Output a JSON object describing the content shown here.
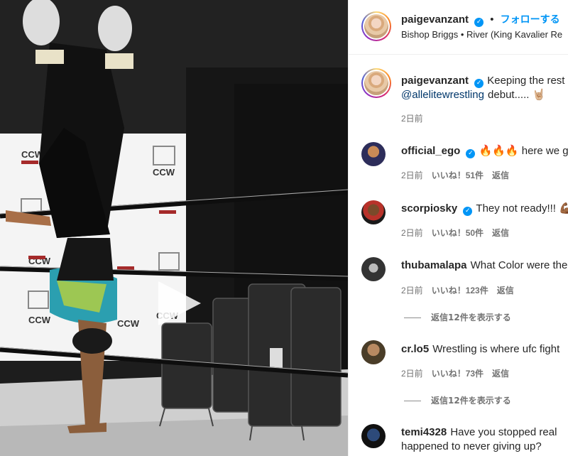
{
  "post": {
    "username": "paigevanzant",
    "follow_label": "フォローする",
    "separator": "•",
    "audio_artist": "Bishop Briggs",
    "audio_title": "River (King Kavalier Re",
    "video": {
      "banner_logo": "CCW",
      "play_icon": "play-icon"
    }
  },
  "caption": {
    "username": "paigevanzant",
    "text": "Keeping the rest",
    "mention": "@allelitewrestling",
    "text2": "debut..... 🤘🏼",
    "time": "2日前"
  },
  "comments": [
    {
      "username": "official_ego",
      "verified": true,
      "text": "🔥🔥🔥 here we go",
      "time": "2日前",
      "likes": "いいね！51件",
      "reply": "返信"
    },
    {
      "username": "scorpiosky",
      "verified": true,
      "text": "They not ready!!! 💪🏾",
      "time": "2日前",
      "likes": "いいね！50件",
      "reply": "返信"
    },
    {
      "username": "thubamalapa",
      "verified": false,
      "text": "What Color were the",
      "time": "2日前",
      "likes": "いいね！123件",
      "reply": "返信",
      "view_replies": "返信12件を表示する"
    },
    {
      "username": "cr.lo5",
      "verified": false,
      "text": "Wrestling is where ufc fight",
      "time": "2日前",
      "likes": "いいね！73件",
      "reply": "返信",
      "view_replies": "返信12件を表示する"
    },
    {
      "username": "temi4328",
      "verified": false,
      "text": "Have you stopped real",
      "text2": "happened to never giving up?"
    }
  ],
  "colors": {
    "accent": "#0095f6",
    "link": "#00376b",
    "muted": "#737373"
  }
}
